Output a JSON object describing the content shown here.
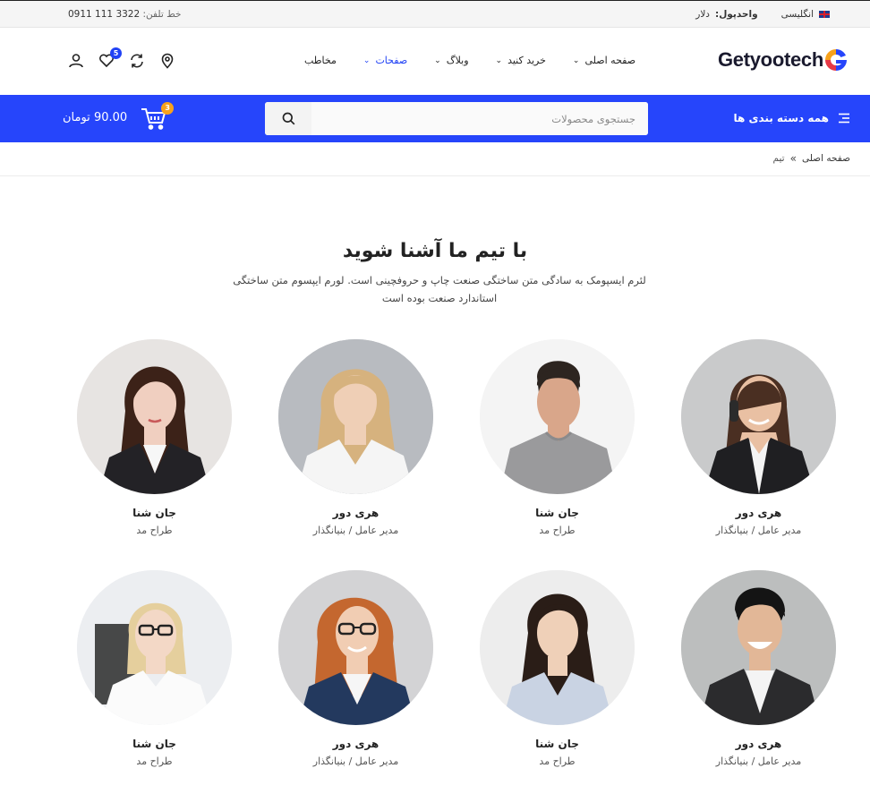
{
  "topbar": {
    "language": "انگلیسی",
    "currency_label": "واحدپول:",
    "currency_value": "دلار",
    "phone_label": "خط تلفن:",
    "phone_number": "0911 111 3322"
  },
  "header": {
    "logo_text": "Getyootech",
    "nav": [
      {
        "label": "صفحه اصلی",
        "has_dropdown": true,
        "active": false
      },
      {
        "label": "خرید کنید",
        "has_dropdown": true,
        "active": false
      },
      {
        "label": "وبلاگ",
        "has_dropdown": true,
        "active": false
      },
      {
        "label": "صفحات",
        "has_dropdown": true,
        "active": true
      },
      {
        "label": "مخاطب",
        "has_dropdown": false,
        "active": false
      }
    ],
    "wishlist_count": "5",
    "accent": "#2142f5"
  },
  "bluebar": {
    "background": "#2645fb",
    "categories_label": "همه دسته بندی ها",
    "search_placeholder": "جستجوی محصولات",
    "cart_total": "90.00 تومان",
    "cart_count": "3"
  },
  "breadcrumb": {
    "home": "صفحه اصلی",
    "current": "تیم"
  },
  "section": {
    "title": "با تیم ما آشنا شوید",
    "description": "لئرم ایسپومک به سادگی متن ساختگی صنعت چاپ و حروفچینی است. لورم ایپسوم متن ساختگی استاندارد صنعت بوده است"
  },
  "team": [
    {
      "name": "هری دور",
      "role": "مدیر عامل / بنیانگذار",
      "photo": "woman-phone-portrait"
    },
    {
      "name": "جان شنا",
      "role": "طراح مد",
      "photo": "man-gray-shirt-portrait"
    },
    {
      "name": "هری دور",
      "role": "مدیر عامل / بنیانگذار",
      "photo": "blonde-woman-portrait"
    },
    {
      "name": "جان شنا",
      "role": "طراح مد",
      "photo": "brunette-woman-portrait"
    },
    {
      "name": "هری دور",
      "role": "مدیر عامل / بنیانگذار",
      "photo": "smiling-man-suit-portrait"
    },
    {
      "name": "جان شنا",
      "role": "طراح مد",
      "photo": "asian-woman-portrait"
    },
    {
      "name": "هری دور",
      "role": "مدیر عامل / بنیانگذار",
      "photo": "redhead-woman-glasses-portrait"
    },
    {
      "name": "جان شنا",
      "role": "طراح مد",
      "photo": "blonde-woman-glasses-portrait"
    }
  ]
}
